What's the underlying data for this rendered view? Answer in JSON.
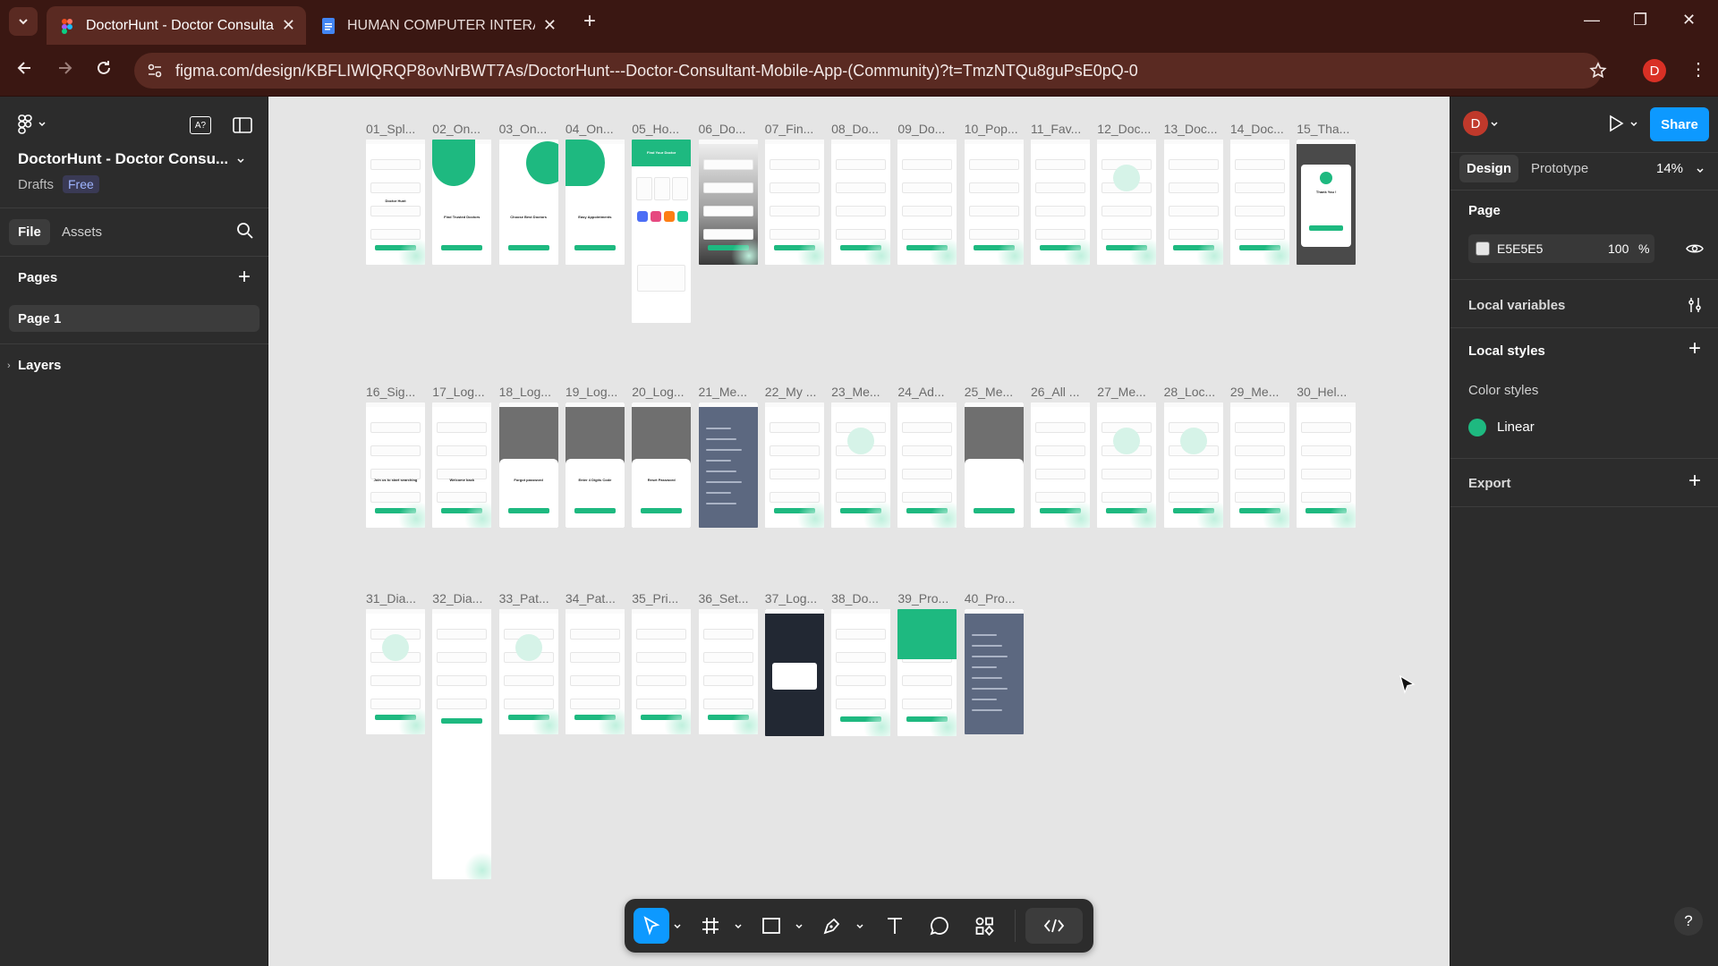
{
  "browser": {
    "tabs": [
      {
        "title": "DoctorHunt - Doctor Consultan",
        "active": true
      },
      {
        "title": "HUMAN COMPUTER INTERACTI",
        "active": false
      }
    ],
    "url": "figma.com/design/KBFLIWlQRQP8ovNrBWT7As/DoctorHunt---Doctor-Consultant-Mobile-App-(Community)?t=TmzNTQu8guPsE0pQ-0",
    "profile_initial": "D"
  },
  "left_panel": {
    "file_name": "DoctorHunt - Doctor Consu...",
    "location": "Drafts",
    "plan_badge": "Free",
    "tabs": [
      "File",
      "Assets"
    ],
    "pages_heading": "Pages",
    "pages": [
      "Page 1"
    ],
    "layers_heading": "Layers"
  },
  "right_panel": {
    "avatar_initial": "D",
    "share_label": "Share",
    "tabs": [
      "Design",
      "Prototype"
    ],
    "zoom": "14%",
    "page_heading": "Page",
    "page_color_hex": "E5E5E5",
    "page_opacity": "100",
    "percent_sign": "%",
    "local_variables": "Local variables",
    "local_styles": "Local styles",
    "color_styles": "Color styles",
    "color_style_name": "Linear",
    "export": "Export",
    "help": "?"
  },
  "colors": {
    "accent_green": "#1eb980",
    "figma_blue": "#0d99ff",
    "browser_chrome": "#3a1712",
    "panel_bg": "#2c2c2c",
    "canvas_bg": "#e5e5e5"
  },
  "canvas": {
    "frames_row1": [
      "01_Spl...",
      "02_On...",
      "03_On...",
      "04_On...",
      "05_Ho...",
      "06_Do...",
      "07_Fin...",
      "08_Do...",
      "09_Do...",
      "10_Pop...",
      "11_Fav...",
      "12_Doc...",
      "13_Doc...",
      "14_Doc...",
      "15_Tha..."
    ],
    "frames_row2": [
      "16_Sig...",
      "17_Log...",
      "18_Log...",
      "19_Log...",
      "20_Log...",
      "21_Me...",
      "22_My ...",
      "23_Me...",
      "24_Ad...",
      "25_Me...",
      "26_All ...",
      "27_Me...",
      "28_Loc...",
      "29_Me...",
      "30_Hel..."
    ],
    "frames_row3": [
      "31_Dia...",
      "32_Dia...",
      "33_Pat...",
      "34_Pat...",
      "35_Pri...",
      "36_Set...",
      "37_Log...",
      "38_Do...",
      "39_Pro...",
      "40_Pro..."
    ],
    "screen_texts": {
      "splash_brand": "Doctor Hunt",
      "onboard_2": "Find Trusted Doctors",
      "onboard_3": "Choose Best Doctors",
      "onboard_4": "Easy Appointments",
      "thank_you": "Thank You !",
      "home_header": "Find Your Doctor",
      "welcome_1": "Join us to start searching",
      "welcome_2": "Welcome back",
      "forgot": "Forgot password",
      "digit_code": "Enter 4 Digits Code",
      "reset": "Reset Password",
      "logout": "Log Out"
    }
  },
  "bottom_toolbar": {
    "tools": [
      "move-tool",
      "frame-tool",
      "shape-tool",
      "pen-tool",
      "text-tool",
      "comment-tool",
      "resources-tool",
      "dev-mode-toggle"
    ]
  }
}
